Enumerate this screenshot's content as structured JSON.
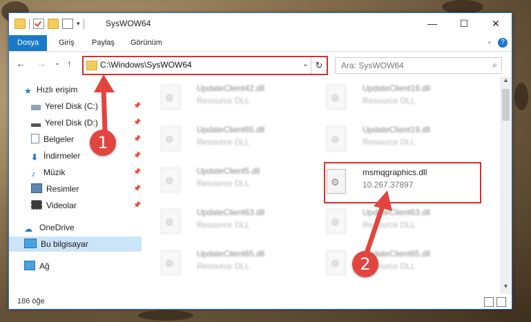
{
  "window": {
    "title": "SysWOW64"
  },
  "controls": {
    "minimize": "—",
    "maximize": "☐",
    "close": "✕"
  },
  "ribbon": {
    "tabs": [
      "Dosya",
      "Giriş",
      "Paylaş",
      "Görünüm"
    ],
    "help": "?"
  },
  "nav": {
    "back": "←",
    "forward": "→",
    "dropdown": "⌄",
    "up": "↑",
    "address": "C:\\Windows\\SysWOW64",
    "address_dropdown": "⌄",
    "refresh": "↻",
    "search_placeholder": "Ara: SysWOW64",
    "search_icon": "⌕"
  },
  "sidebar": {
    "quick_access": "Hızlı erişim",
    "items": [
      {
        "label": "Yerel Disk (C:)",
        "icon": "drive-icon"
      },
      {
        "label": "Yerel Disk (D:)",
        "icon": "drive-icon"
      },
      {
        "label": "Belgeler",
        "icon": "documents-icon"
      },
      {
        "label": "İndirmeler",
        "icon": "download-icon"
      },
      {
        "label": "Müzik",
        "icon": "music-icon"
      },
      {
        "label": "Resimler",
        "icon": "pictures-icon"
      },
      {
        "label": "Videolar",
        "icon": "videos-icon"
      }
    ],
    "onedrive": "OneDrive",
    "this_pc": "Bu bilgisayar",
    "network": "Ağ",
    "pin": "📌"
  },
  "files": {
    "left": [
      {
        "name": "UpdateClient42.dll",
        "type": "Resource DLL"
      },
      {
        "name": "UpdateClient65.dll",
        "type": "Resource DLL"
      },
      {
        "name": "UpdateClient5.dll",
        "type": "Resource DLL"
      },
      {
        "name": "UpdateClient63.dll",
        "type": "Resource DLL"
      },
      {
        "name": "UpdateClient65.dll",
        "type": "Resource DLL"
      }
    ],
    "right": [
      {
        "name": "UpdateClient19.dll",
        "type": "Resource DLL"
      },
      {
        "name": "UpdateClient19.dll",
        "type": "Resource DLL"
      },
      {
        "name": "msmqgraphics.dll",
        "type": "10.267.37897"
      },
      {
        "name": "UpdateClient63.dll",
        "type": "Resource DLL"
      },
      {
        "name": "UpdateClient65.dll",
        "type": "Resource DLL"
      }
    ]
  },
  "status": {
    "count": "186 öğe"
  },
  "annotations": {
    "badge1": "1",
    "badge2": "2",
    "color": "#e2453f"
  }
}
